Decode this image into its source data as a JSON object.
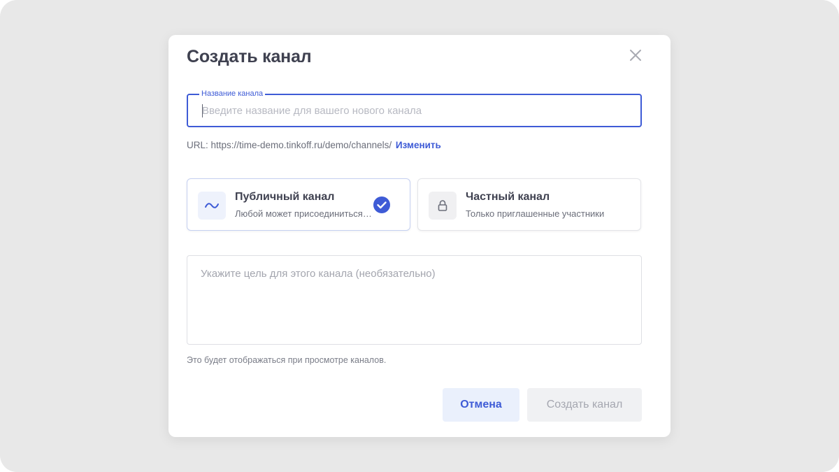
{
  "modal": {
    "title": "Создать канал",
    "close_icon": "close-icon"
  },
  "name_field": {
    "label": "Название канала",
    "placeholder": "Введите название для вашего нового канала",
    "value": ""
  },
  "url": {
    "prefix": "URL: https://time-demo.tinkoff.ru/demo/channels/",
    "change_label": "Изменить"
  },
  "options": [
    {
      "title": "Публичный канал",
      "description": "Любой может присоединиться к этому каналу",
      "icon": "globe-icon",
      "selected": true
    },
    {
      "title": "Частный канал",
      "description": "Только приглашенные участники",
      "icon": "lock-icon",
      "selected": false
    }
  ],
  "purpose": {
    "placeholder": "Укажите цель для этого канала (необязательно)",
    "value": "",
    "hint": "Это будет отображаться при просмотре каналов."
  },
  "buttons": {
    "cancel": "Отмена",
    "create": "Создать канал"
  },
  "colors": {
    "accent": "#3e5bd6",
    "backdrop": "#e8e8e8",
    "cancel_bg": "#eaf0fc",
    "disabled_bg": "#f0f1f3",
    "disabled_text": "#a5a7b0"
  }
}
